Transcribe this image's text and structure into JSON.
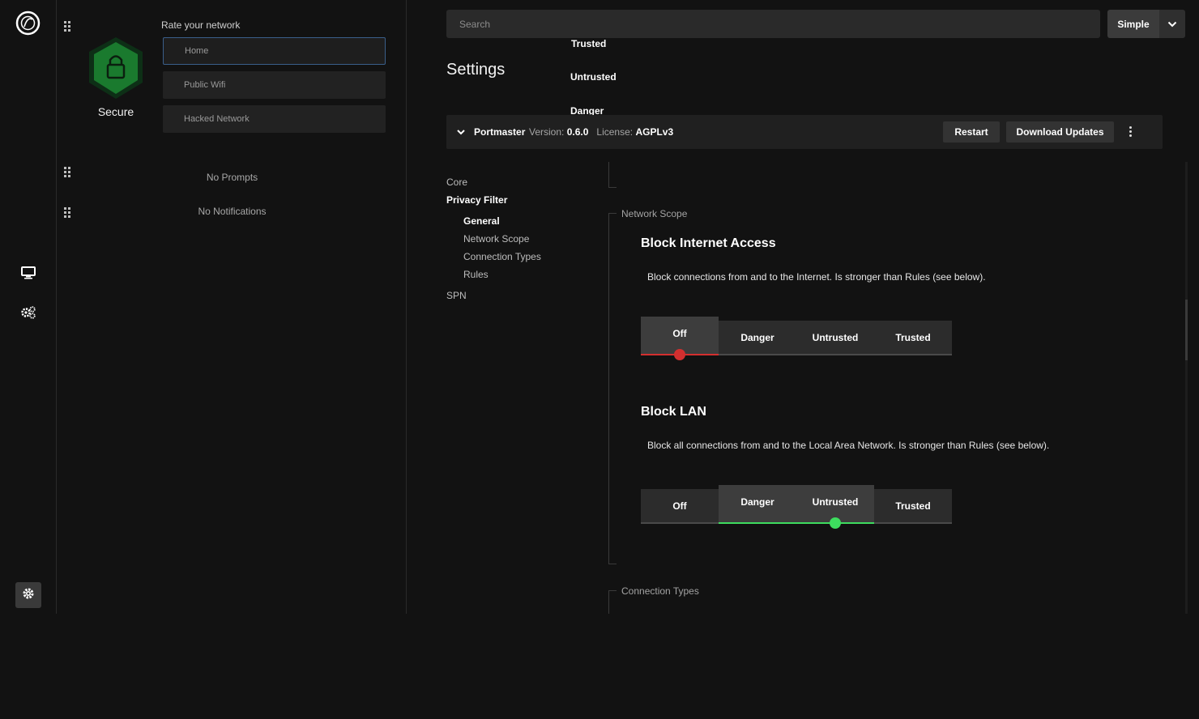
{
  "nav": {
    "logo_icon": "portmaster-logo-icon",
    "items": [
      {
        "name": "monitor-icon"
      },
      {
        "name": "gears-icon"
      }
    ],
    "settings_icon": "gear-icon"
  },
  "sidebar": {
    "status_label": "Secure",
    "status_color": "#1a7a2e",
    "rate_title": "Rate your network",
    "rate_options": [
      {
        "label": "Trusted",
        "sub": "Home",
        "active": true
      },
      {
        "label": "Untrusted",
        "sub": "Public Wifi",
        "active": false
      },
      {
        "label": "Danger",
        "sub": "Hacked Network",
        "active": false
      }
    ],
    "prompts_empty": "No Prompts",
    "notifications_empty": "No Notifications"
  },
  "header": {
    "search_placeholder": "Search",
    "mode_label": "Simple"
  },
  "page_title": "Settings",
  "app_bar": {
    "name": "Portmaster",
    "version_label": "Version:",
    "version": "0.6.0",
    "license_label": "License:",
    "license": "AGPLv3",
    "restart_label": "Restart",
    "download_label": "Download Updates"
  },
  "toc": {
    "core": "Core",
    "privacy_filter": "Privacy Filter",
    "general": "General",
    "network_scope": "Network Scope",
    "connection_types": "Connection Types",
    "rules": "Rules",
    "spn": "SPN"
  },
  "content": {
    "network_scope_label": "Network Scope",
    "connection_types_label": "Connection Types",
    "block_internet": {
      "title": "Block Internet Access",
      "description": "Block connections from and to the Internet. Is stronger than Rules (see below).",
      "options": [
        "Off",
        "Danger",
        "Untrusted",
        "Trusted"
      ],
      "selected": "Off",
      "accent": "#d32f2f"
    },
    "block_lan": {
      "title": "Block LAN",
      "description": "Block all connections from and to the Local Area Network. Is stronger than Rules (see below).",
      "options": [
        "Off",
        "Danger",
        "Untrusted",
        "Trusted"
      ],
      "selected": "Untrusted",
      "selected_range": [
        "Danger",
        "Untrusted"
      ],
      "accent": "#3ddc5e"
    }
  }
}
